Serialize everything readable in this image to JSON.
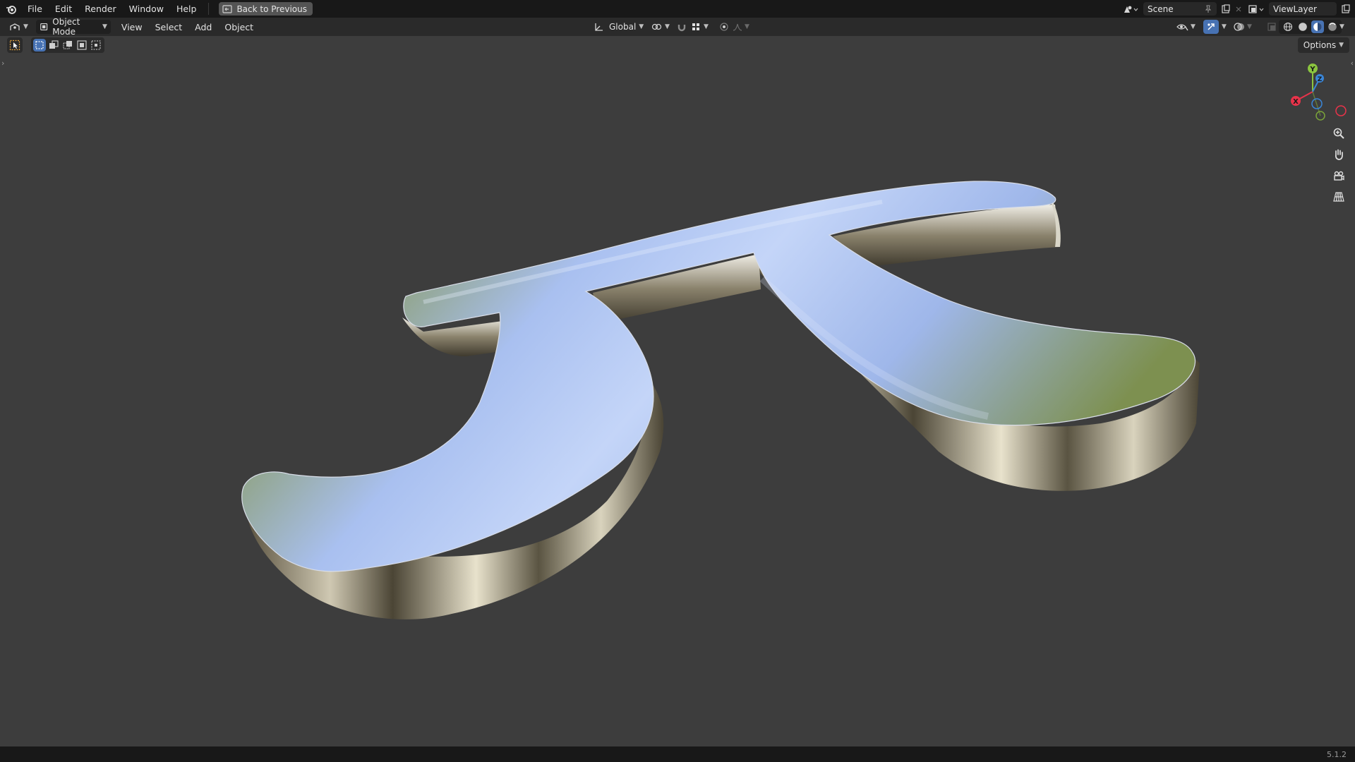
{
  "topbar": {
    "menus": [
      "File",
      "Edit",
      "Render",
      "Window",
      "Help"
    ],
    "back_button": "Back to Previous",
    "scene_label": "Scene",
    "view_layer_label": "ViewLayer"
  },
  "viewport_header": {
    "mode_label": "Object Mode",
    "menus": [
      "View",
      "Select",
      "Add",
      "Object"
    ],
    "transform_orientation": "Global"
  },
  "viewport": {
    "options_label": "Options",
    "gizmo_axes": {
      "x": "X",
      "y": "Y",
      "z": "Z"
    },
    "object": "pi-symbol-mesh",
    "colors": {
      "background": "#3d3d3d",
      "axis_x": "#e8334a",
      "axis_y": "#8bc53f",
      "axis_z": "#3a86d8",
      "active_button": "#4772b3"
    }
  },
  "statusbar": {
    "version": "5.1.2"
  }
}
